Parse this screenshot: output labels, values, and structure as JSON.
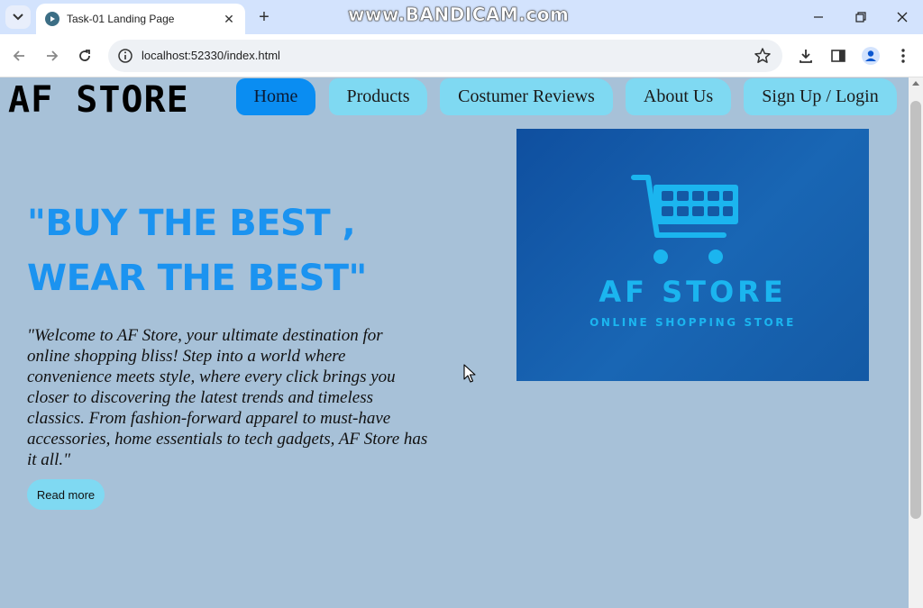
{
  "browser": {
    "tab_title": "Task-01 Landing Page",
    "url": "localhost:52330/index.html",
    "watermark": "www.BANDICAM.com"
  },
  "site": {
    "brand": "AF STORE",
    "nav": [
      {
        "label": "Home",
        "active": true
      },
      {
        "label": "Products",
        "active": false
      },
      {
        "label": "Costumer Reviews",
        "active": false
      },
      {
        "label": "About Us",
        "active": false
      },
      {
        "label": "Sign Up / Login",
        "active": false
      }
    ],
    "headline_line1": "\"BUY THE BEST ,",
    "headline_line2": "WEAR THE BEST\"",
    "intro": "\"Welcome to AF Store, your ultimate destination for online shopping bliss! Step into a world where convenience meets style, where every click brings you closer to discovering the latest trends and timeless classics. From fashion-forward apparel to must-have accessories, home essentials to tech gadgets, AF Store has it all.\"",
    "read_more_label": "Read more",
    "hero_logo_title": "AF STORE",
    "hero_logo_subtitle": "ONLINE SHOPPING STORE"
  },
  "colors": {
    "page_bg": "#a7c1d8",
    "nav_button": "#7fd9f2",
    "nav_active": "#0a8df2",
    "headline": "#1b93f0",
    "hero_bg": "#145aa5",
    "hero_logo": "#1bb5ef"
  },
  "icons": [
    "tab-search-icon",
    "favicon-icon",
    "close-icon",
    "plus-icon",
    "minimize-icon",
    "restore-icon",
    "close-window-icon",
    "back-icon",
    "forward-icon",
    "reload-icon",
    "info-icon",
    "star-icon",
    "download-icon",
    "side-panel-icon",
    "profile-icon",
    "menu-icon",
    "cart-icon",
    "cursor-icon"
  ]
}
